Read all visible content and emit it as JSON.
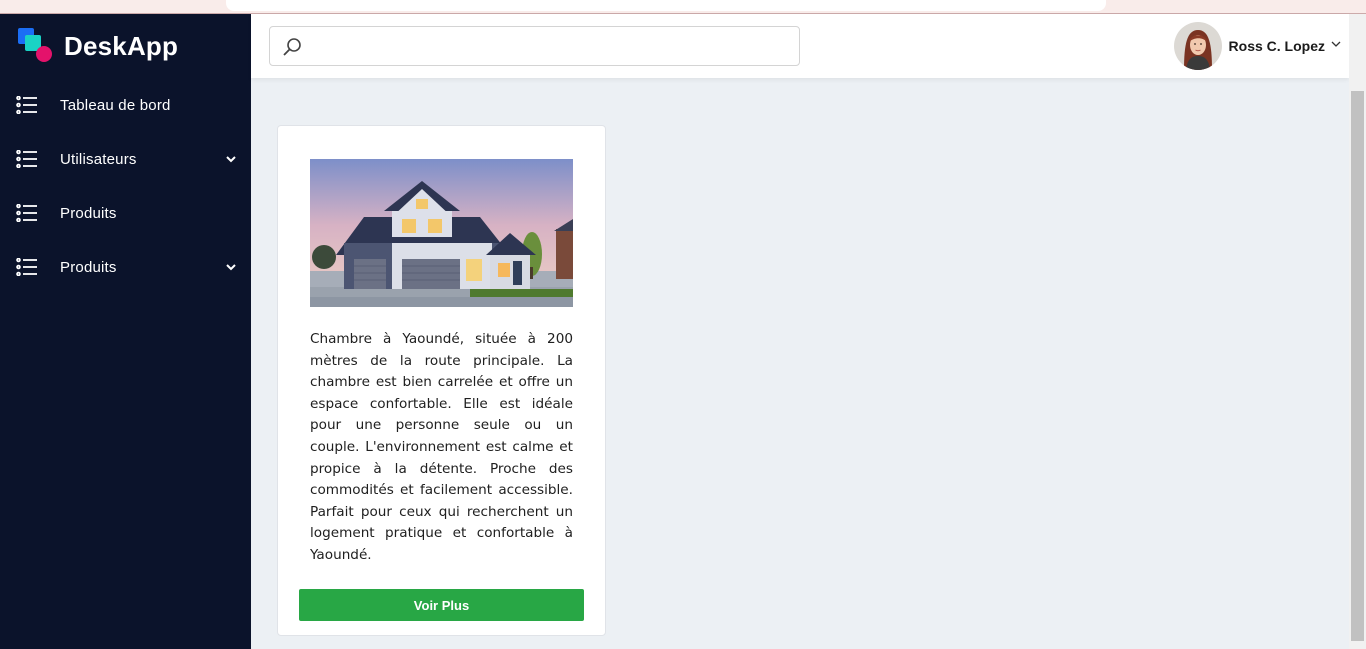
{
  "app": {
    "name": "DeskApp"
  },
  "sidebar": {
    "items": [
      {
        "label": "Tableau de bord",
        "icon": "list-icon",
        "has_submenu": false
      },
      {
        "label": "Utilisateurs",
        "icon": "list-icon",
        "has_submenu": true
      },
      {
        "label": "Produits",
        "icon": "list-icon",
        "has_submenu": false
      },
      {
        "label": "Produits",
        "icon": "list-icon",
        "has_submenu": true
      }
    ]
  },
  "header": {
    "search": {
      "value": "",
      "placeholder": "",
      "icon": "search-icon"
    },
    "user": {
      "name": "Ross C. Lopez",
      "icon": "chevron-down-icon"
    }
  },
  "card": {
    "image": "house-photo",
    "description": "Chambre à Yaoundé, située à 200 mètres de la route principale. La chambre est bien carrelée et offre un espace confortable. Elle est idéale pour une personne seule ou un couple. L'environnement est calme et propice à la détente. Proche des commodités et facilement accessible. Parfait pour ceux qui recherchent un logement pratique et confortable à Yaoundé.",
    "button_label": "Voir Plus"
  },
  "colors": {
    "sidebar_bg": "#0b132b",
    "content_bg": "#ecf0f4",
    "button_bg": "#28a745"
  }
}
